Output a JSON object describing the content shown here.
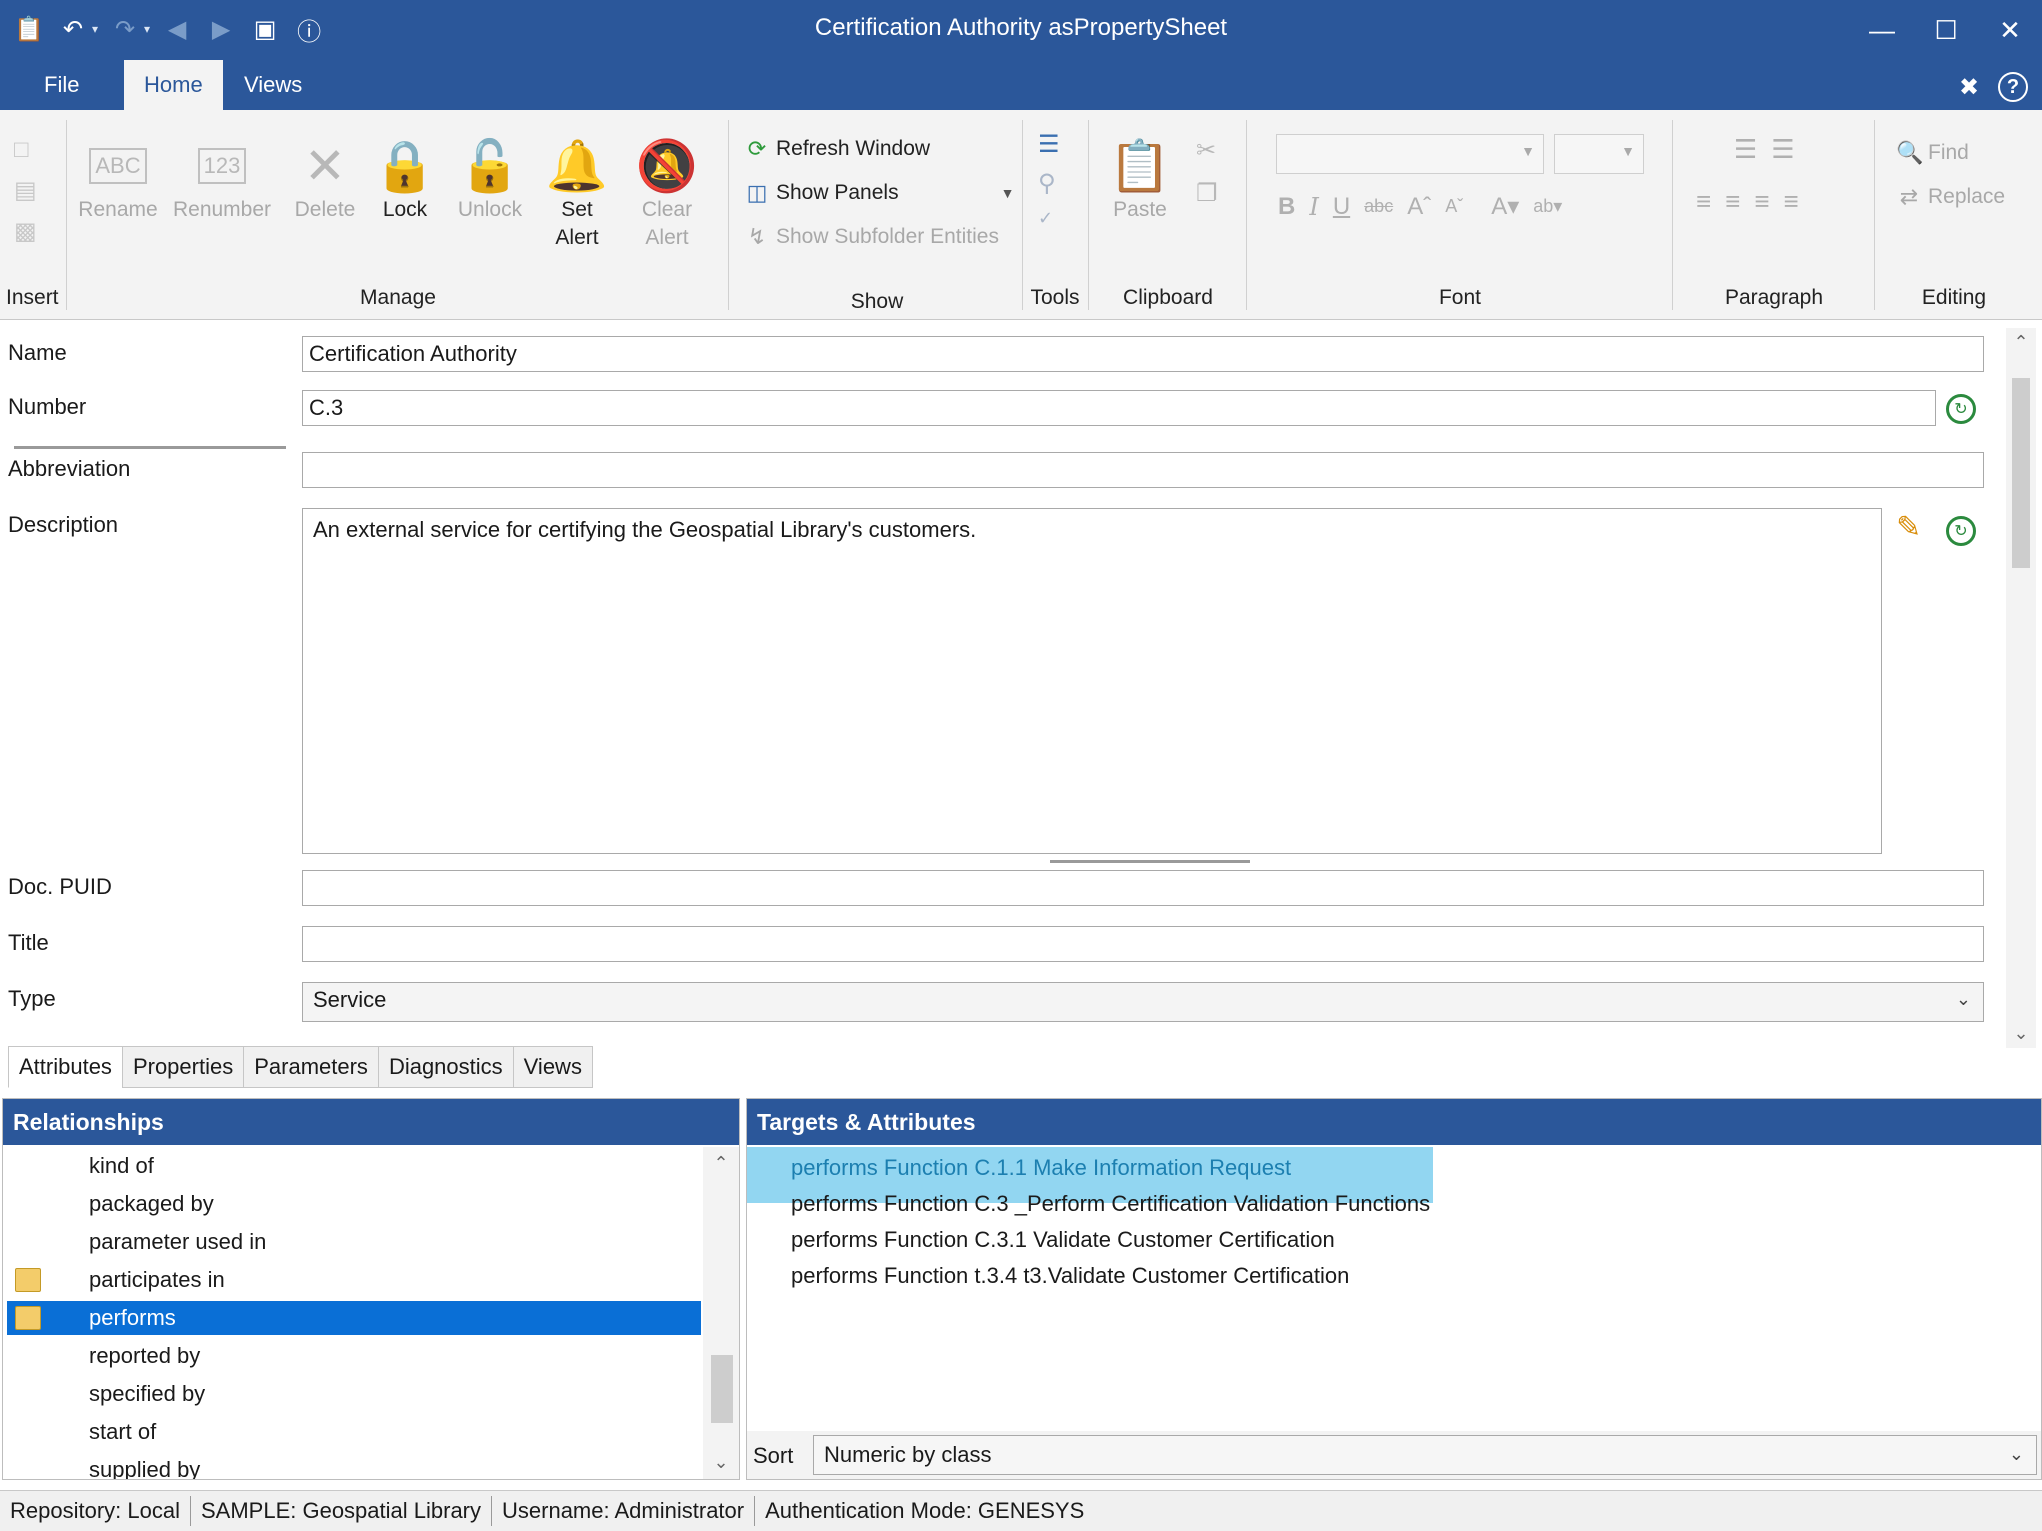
{
  "window": {
    "title": "Certification Authority asPropertySheet"
  },
  "ribbon_tabs": [
    "File",
    "Home",
    "Views"
  ],
  "ribbon": {
    "groups": {
      "insert": "Insert",
      "manage": "Manage",
      "show": "Show",
      "tools": "Tools",
      "clipboard": "Clipboard",
      "font": "Font",
      "paragraph": "Paragraph",
      "editing": "Editing"
    },
    "buttons": {
      "rename": "Rename",
      "renumber": "Renumber",
      "delete": "Delete",
      "lock": "Lock",
      "unlock": "Unlock",
      "set_alert_1": "Set",
      "set_alert_2": "Alert",
      "clear_alert_1": "Clear",
      "clear_alert_2": "Alert",
      "refresh_window": "Refresh Window",
      "show_panels": "Show Panels",
      "show_subfolder": "Show Subfolder Entities",
      "paste": "Paste",
      "find": "Find",
      "replace": "Replace"
    }
  },
  "fields": {
    "name_label": "Name",
    "name_value": "Certification Authority",
    "number_label": "Number",
    "number_value": "C.3",
    "abbreviation_label": "Abbreviation",
    "abbreviation_value": "",
    "description_label": "Description",
    "description_value": "An external service for certifying the Geospatial Library's customers.",
    "docpuid_label": "Doc. PUID",
    "docpuid_value": "",
    "title_label": "Title",
    "title_value": "",
    "type_label": "Type",
    "type_value": "Service"
  },
  "bottom_tabs": [
    "Attributes",
    "Properties",
    "Parameters",
    "Diagnostics",
    "Views"
  ],
  "relationships": {
    "header": "Relationships",
    "items": [
      {
        "label": "kind of"
      },
      {
        "label": "packaged by"
      },
      {
        "label": "parameter used in"
      },
      {
        "label": "participates in"
      },
      {
        "label": "performs"
      },
      {
        "label": "reported by"
      },
      {
        "label": "specified by"
      },
      {
        "label": "start of"
      },
      {
        "label": "supplied by"
      }
    ],
    "selected": "performs"
  },
  "targets": {
    "header": "Targets & Attributes",
    "items": [
      "performs Function C.1.1 Make Information Request",
      "performs Function C.3 _Perform Certification Validation Functions",
      "performs Function C.3.1 Validate Customer Certification",
      "performs Function t.3.4 t3.Validate Customer Certification"
    ],
    "sort_label": "Sort",
    "sort_value": "Numeric by class"
  },
  "statusbar": {
    "repository": "Repository: Local",
    "project": "SAMPLE: Geospatial Library",
    "username": "Username: Administrator",
    "auth": "Authentication Mode: GENESYS"
  },
  "icons": {
    "qat": [
      "project-icon",
      "undo-icon",
      "redo-icon",
      "back-icon",
      "forward-icon",
      "card-icon",
      "info-icon"
    ],
    "lock": "lock-icon",
    "bell": "bell-icon",
    "history": "history-clock-icon",
    "edit": "pencil-icon"
  },
  "colors": {
    "titlebar": "#2b579a",
    "selection": "#0a6fd6",
    "highlight": "#6ec8ec"
  }
}
